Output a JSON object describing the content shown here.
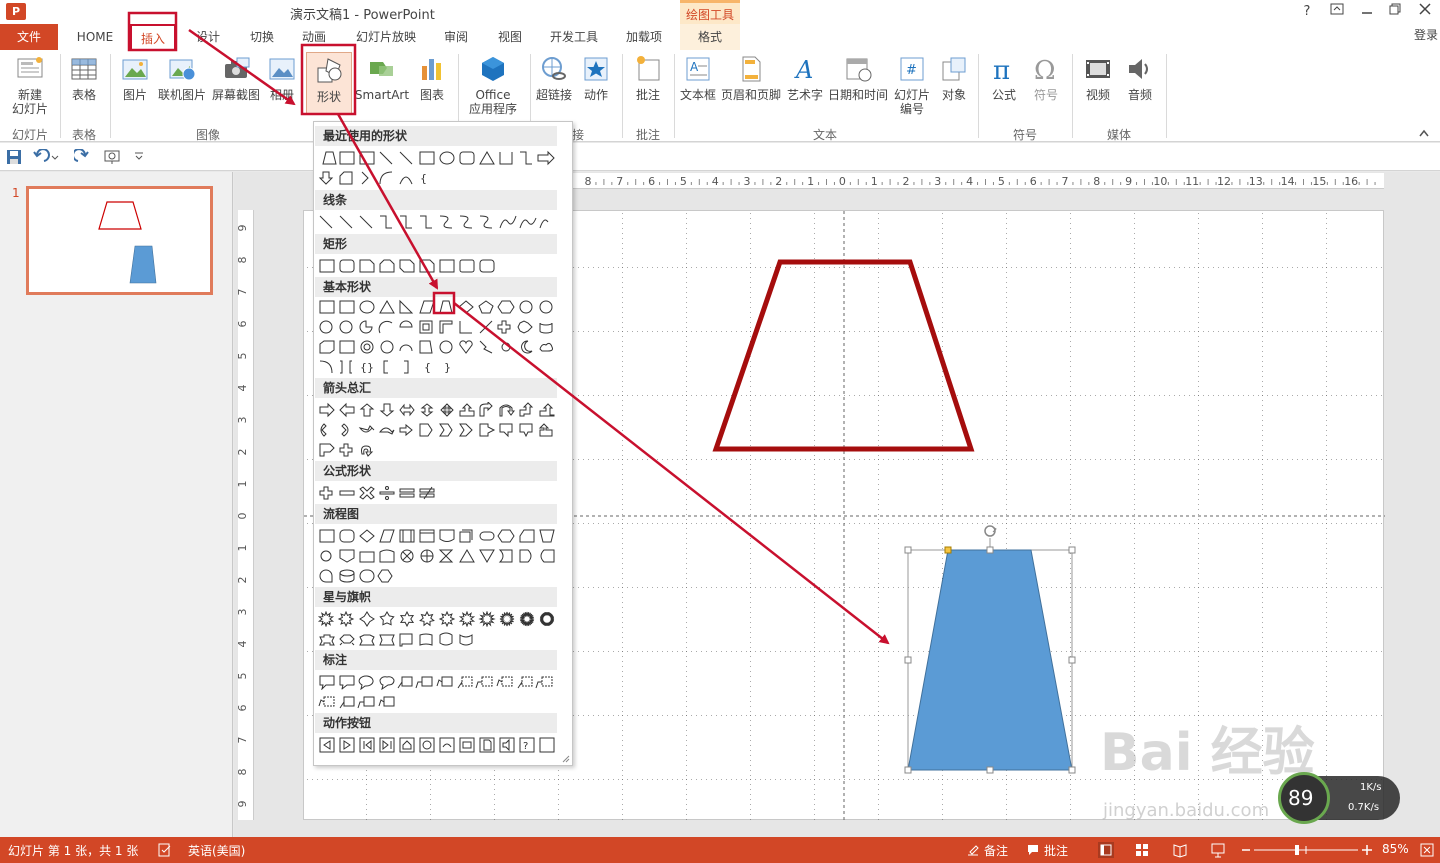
{
  "window": {
    "title": "演示文稿1 - PowerPoint",
    "contextual_tab_group": "绘图工具",
    "help": "?",
    "login": "登录"
  },
  "tabs": [
    {
      "id": "file",
      "label": "文件"
    },
    {
      "id": "home",
      "label": "HOME"
    },
    {
      "id": "insert",
      "label": "插入"
    },
    {
      "id": "design",
      "label": "设计"
    },
    {
      "id": "transitions",
      "label": "切换"
    },
    {
      "id": "animations",
      "label": "动画"
    },
    {
      "id": "slideshow",
      "label": "幻灯片放映"
    },
    {
      "id": "review",
      "label": "审阅"
    },
    {
      "id": "view",
      "label": "视图"
    },
    {
      "id": "developer",
      "label": "开发工具"
    },
    {
      "id": "addins",
      "label": "加载项"
    },
    {
      "id": "format",
      "label": "格式"
    }
  ],
  "ribbon": {
    "buttons": {
      "new_slide": "新建\n幻灯片",
      "table": "表格",
      "picture": "图片",
      "online_picture": "联机图片",
      "screenshot": "屏幕截图",
      "album": "相册",
      "shapes": "形状",
      "smartart": "SmartArt",
      "chart": "图表",
      "office_apps": "Office\n应用程序",
      "hyperlink": "超链接",
      "action": "动作",
      "comment": "批注",
      "textbox": "文本框",
      "header_footer": "页眉和页脚",
      "wordart": "艺术字",
      "datetime": "日期和时间",
      "slide_number": "幻灯片\n编号",
      "object": "对象",
      "equation": "公式",
      "symbol": "符号",
      "video": "视频",
      "audio": "音频"
    },
    "groups": {
      "slides": "幻灯片",
      "tables": "表格",
      "images": "图像",
      "links": "接",
      "comments": "批注",
      "text": "文本",
      "symbols": "符号",
      "media": "媒体"
    }
  },
  "shapes_dropdown": {
    "categories": {
      "recent": "最近使用的形状",
      "lines": "线条",
      "rectangles": "矩形",
      "basic": "基本形状",
      "arrows": "箭头总汇",
      "equation": "公式形状",
      "flowchart": "流程图",
      "stars": "星与旗帜",
      "callouts": "标注",
      "action_buttons": "动作按钮"
    }
  },
  "thumbnail": {
    "number": "1"
  },
  "status_bar": {
    "slide_info": "幻灯片 第 1 张，共 1 张",
    "language": "英语(美国)",
    "notes": "备注",
    "comments": "批注",
    "zoom": "85%"
  },
  "watermark": {
    "text": "Bai 经验",
    "url": "jingyan.baidu.com"
  },
  "net_widget": {
    "percent": "89",
    "up": "1K/s",
    "down": "0.7K/s"
  },
  "colors": {
    "accent": "#d24726",
    "annotation": "#c8102e",
    "outline_shape": "#a50d0d",
    "fill_shape": "#5b9bd5"
  },
  "ruler": {
    "h_ticks": [
      "8",
      "7",
      "6",
      "5",
      "4",
      "3",
      "2",
      "1",
      "0",
      "1",
      "2",
      "3",
      "4",
      "5",
      "6",
      "7",
      "8",
      "9",
      "10",
      "11",
      "12",
      "13",
      "14",
      "15",
      "16"
    ],
    "v_ticks": [
      "9",
      "8",
      "7",
      "6",
      "5",
      "4",
      "3",
      "2",
      "1",
      "0",
      "1",
      "2",
      "3",
      "4",
      "5",
      "6",
      "7",
      "8",
      "9"
    ]
  }
}
